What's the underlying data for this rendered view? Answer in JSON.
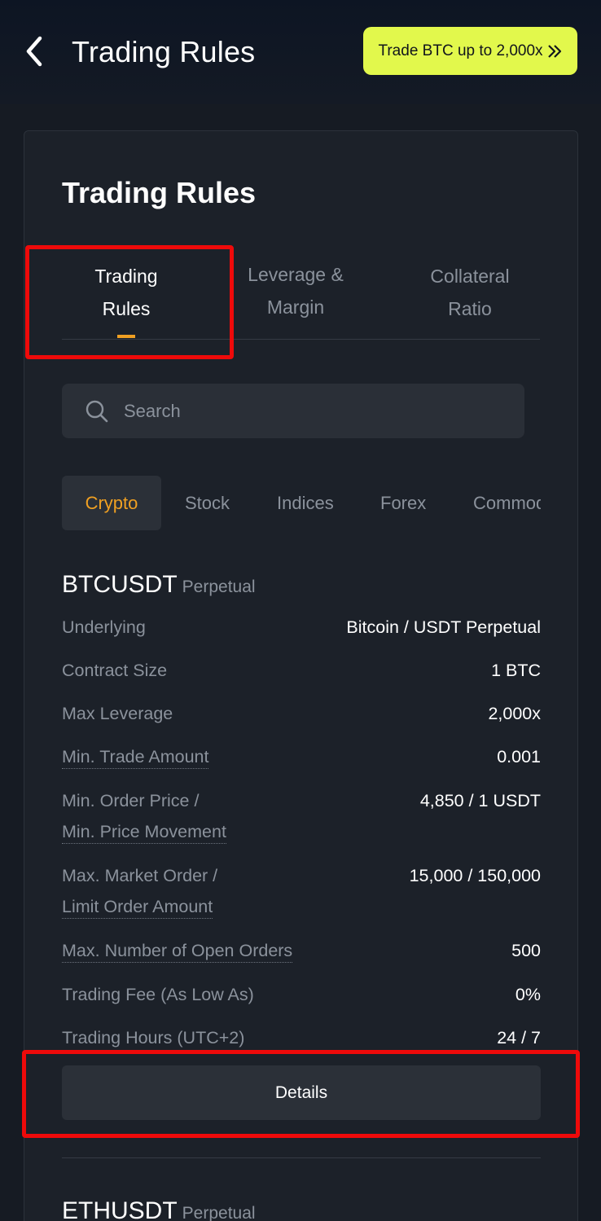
{
  "header": {
    "title": "Trading Rules",
    "promo_label": "Trade BTC up to 2,000x"
  },
  "card": {
    "title": "Trading Rules",
    "tabs": [
      {
        "line1": "Trading",
        "line2": "Rules"
      },
      {
        "line1": "Leverage &",
        "line2": "Margin"
      },
      {
        "line1": "Collateral",
        "line2": "Ratio"
      }
    ],
    "search_placeholder": "Search",
    "categories": [
      "Crypto",
      "Stock",
      "Indices",
      "Forex",
      "Commodities"
    ]
  },
  "instrument": {
    "symbol": "BTCUSDT",
    "type": "Perpetual",
    "rows": [
      {
        "label": "Underlying",
        "value": "Bitcoin / USDT Perpetual"
      },
      {
        "label": "Contract Size",
        "value": "1 BTC"
      },
      {
        "label": "Max Leverage",
        "value": "2,000x"
      },
      {
        "label": "Min. Trade Amount",
        "value": "0.001"
      },
      {
        "label": "Min. Order Price /",
        "label2": "Min. Price Movement",
        "value": "4,850 / 1 USDT"
      },
      {
        "label": "Max. Market Order /",
        "label2": "Limit Order Amount",
        "value": "15,000 / 150,000"
      },
      {
        "label": "Max. Number of Open Orders",
        "value": "500"
      },
      {
        "label": "Trading Fee (As Low As)",
        "value": "0%"
      },
      {
        "label": "Trading Hours (UTC+2)",
        "value": "24 / 7"
      }
    ],
    "details_label": "Details"
  },
  "next_instrument": {
    "symbol": "ETHUSDT",
    "type": "Perpetual"
  },
  "colors": {
    "accent": "#f0a022",
    "promo": "#e2f84c",
    "annotation": "#ee0a0a"
  }
}
